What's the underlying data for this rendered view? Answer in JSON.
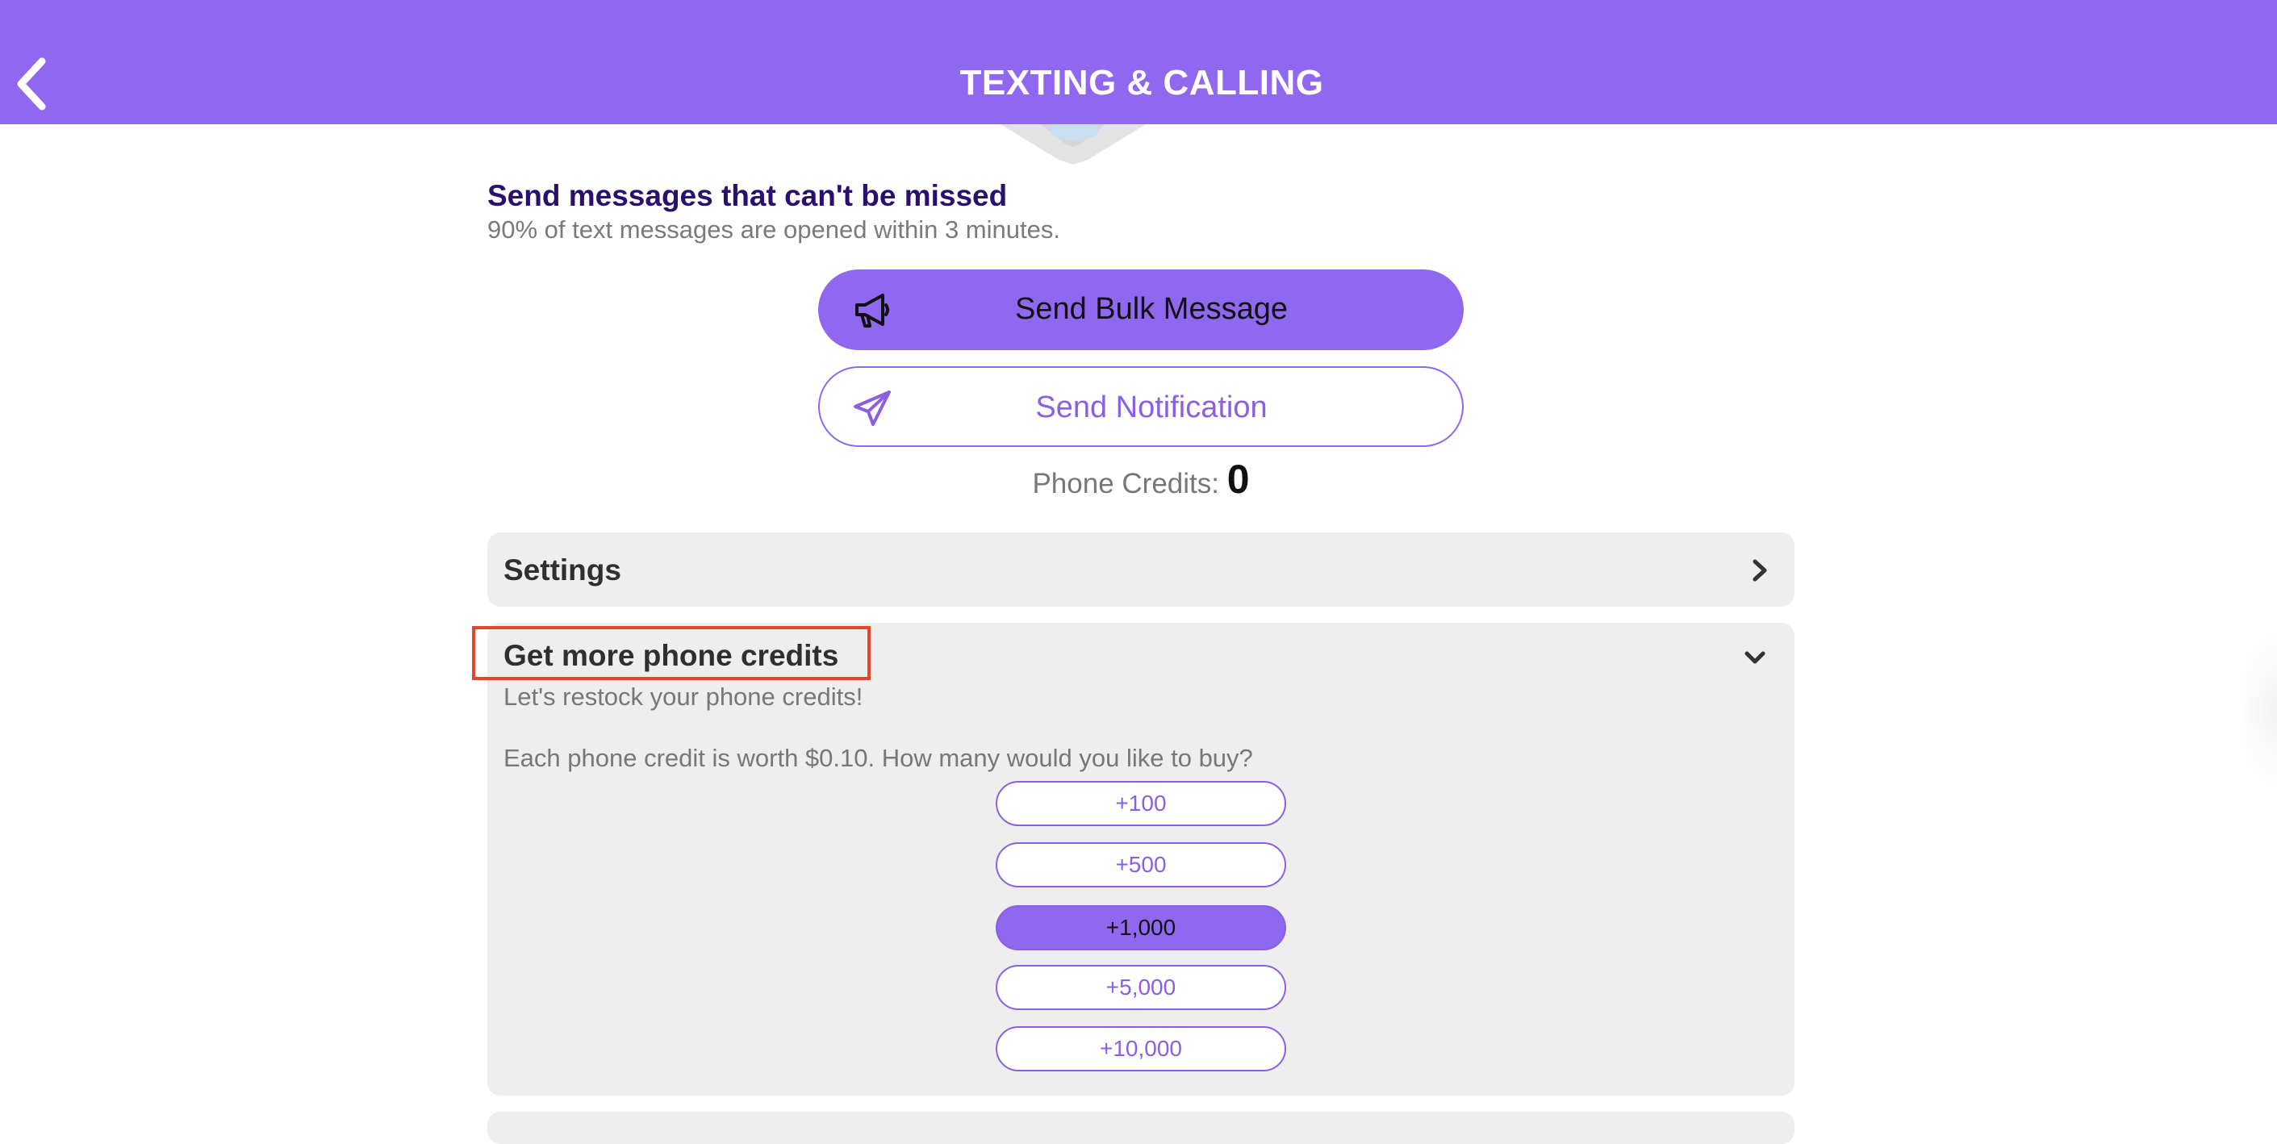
{
  "header": {
    "title": "TEXTING & CALLING",
    "back_icon": "chevron-left-icon"
  },
  "intro": {
    "heading": "Send messages that can't be missed",
    "subheading": "90% of text messages are opened within 3 minutes."
  },
  "actions": {
    "bulk": {
      "label": "Send Bulk Message",
      "icon": "megaphone-icon"
    },
    "notification": {
      "label": "Send Notification",
      "icon": "paper-plane-icon"
    }
  },
  "credits": {
    "label": "Phone Credits:",
    "value": "0"
  },
  "settings_section": {
    "title": "Settings",
    "icon": "chevron-right-icon"
  },
  "buy_section": {
    "title": "Get more phone credits",
    "icon": "chevron-down-icon",
    "subtitle": "Let's restock your phone credits!",
    "prompt": "Each phone credit is worth $0.10. How many would you like to buy?",
    "options": [
      {
        "label": "+100",
        "selected": false
      },
      {
        "label": "+500",
        "selected": false
      },
      {
        "label": "+1,000",
        "selected": true
      },
      {
        "label": "+5,000",
        "selected": false
      },
      {
        "label": "+10,000",
        "selected": false
      }
    ]
  },
  "colors": {
    "brand": "#9068ef",
    "heading": "#2b0f6e",
    "card": "#eeeeee",
    "highlight": "#e0472e"
  }
}
